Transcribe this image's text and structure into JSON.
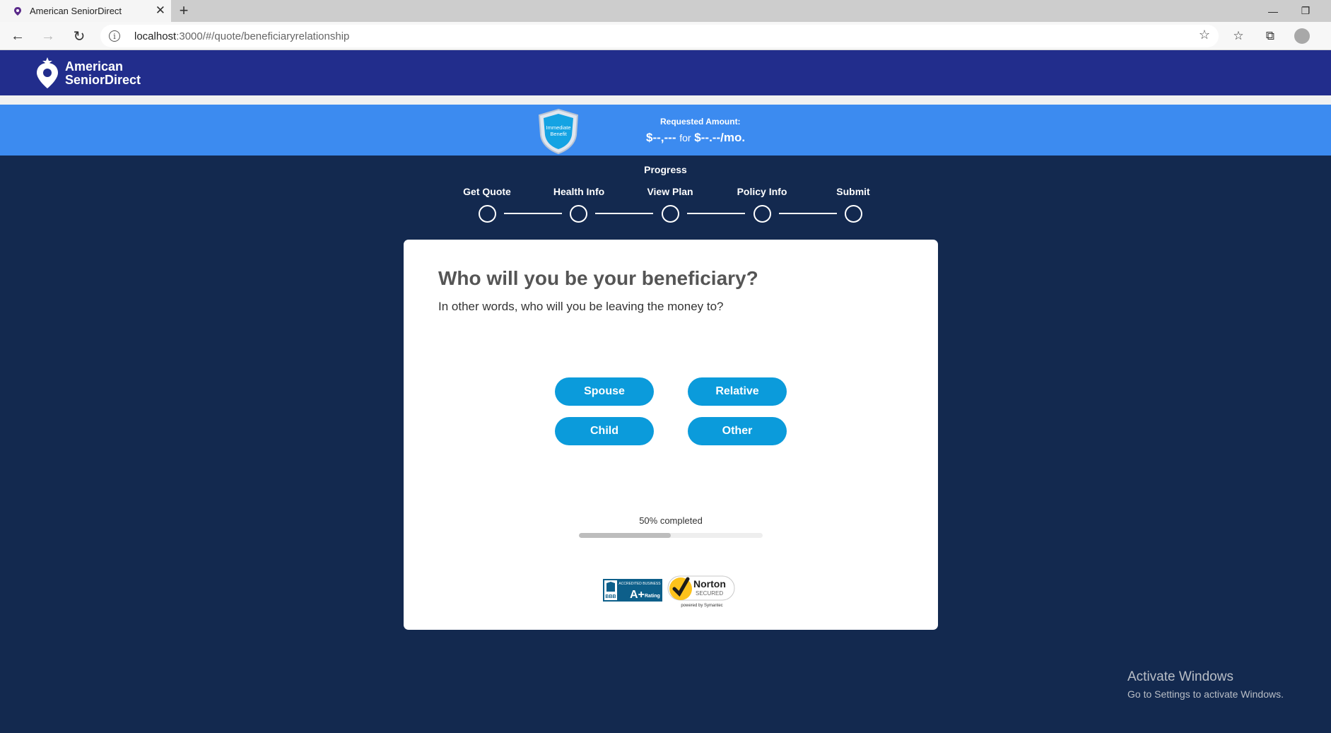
{
  "browser": {
    "tab_title": "American SeniorDirect",
    "url_host": "localhost",
    "url_path": ":3000/#/quote/beneficiaryrelationship"
  },
  "header": {
    "logo_line1": "American",
    "logo_line2": "SeniorDirect"
  },
  "amount_bar": {
    "badge_line1": "Immediate",
    "badge_line2": "Benefit",
    "label": "Requested Amount:",
    "amount": "$--,---",
    "for": "for",
    "monthly": "$--.--/mo."
  },
  "progress": {
    "title": "Progress",
    "steps": [
      "Get Quote",
      "Health Info",
      "View Plan",
      "Policy Info",
      "Submit"
    ]
  },
  "question": {
    "title": "Who will you be your beneficiary?",
    "subtitle": "In other words, who will you be leaving the money to?"
  },
  "choices": {
    "spouse": "Spouse",
    "relative": "Relative",
    "child": "Child",
    "other": "Other"
  },
  "completion": {
    "label": "50% completed",
    "fraction": 0.5
  },
  "trust_badges": {
    "bbb_top": "ACCREDITED BUSINESS",
    "bbb_logo": "BBB",
    "bbb_rating": "A+",
    "bbb_rating_label": "Rating",
    "norton_name": "Norton",
    "norton_secured": "SECURED",
    "norton_powered": "powered by Symantec"
  },
  "windows_watermark": {
    "line1": "Activate Windows",
    "line2": "Go to Settings to activate Windows."
  },
  "colors": {
    "header": "#222d8c",
    "amount_bar": "#3c8bf0",
    "page_bg": "#13294f",
    "choice_button": "#0b9bdb"
  }
}
